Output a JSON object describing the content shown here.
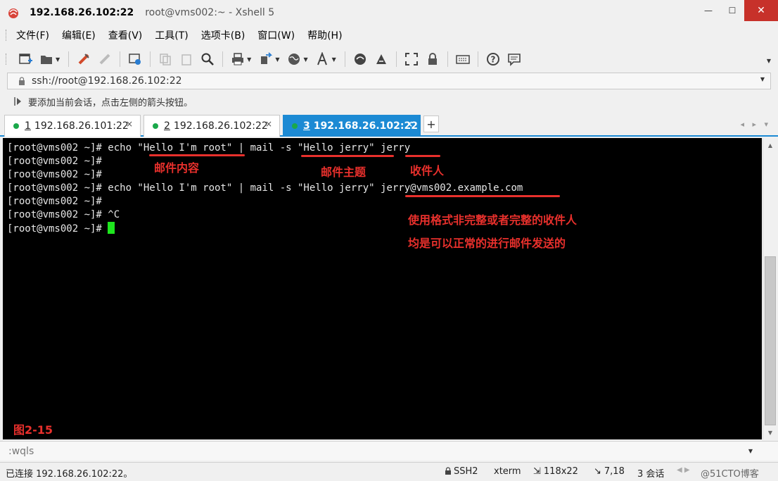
{
  "window": {
    "host": "192.168.26.102:22",
    "subtitle": "root@vms002:~ - Xshell 5",
    "minimize": "—",
    "maximize": "☐",
    "close": "✕"
  },
  "menu": [
    "文件(F)",
    "编辑(E)",
    "查看(V)",
    "工具(T)",
    "选项卡(B)",
    "窗口(W)",
    "帮助(H)"
  ],
  "address": {
    "value": "ssh://root@192.168.26.102:22"
  },
  "hint": {
    "text": "要添加当前会话，点击左侧的箭头按钮。"
  },
  "tabs": [
    {
      "num": "1",
      "label": "192.168.26.101:22",
      "status": "connected",
      "active": false
    },
    {
      "num": "2",
      "label": "192.168.26.102:22",
      "status": "connected",
      "active": false
    },
    {
      "num": "3",
      "label": "192.168.26.102:22",
      "status": "connected",
      "active": true
    }
  ],
  "tab_add": "+",
  "tab_nav": "◂ ▸ ▾",
  "tab_close": "×",
  "terminal": {
    "lines": [
      "[root@vms002 ~]# echo \"Hello I'm root\" | mail -s \"Hello jerry\" jerry",
      "[root@vms002 ~]#",
      "[root@vms002 ~]#",
      "[root@vms002 ~]# echo \"Hello I'm root\" | mail -s \"Hello jerry\" jerry@vms002.example.com",
      "[root@vms002 ~]#",
      "[root@vms002 ~]# ^C",
      "[root@vms002 ~]# "
    ],
    "cursor_color": "#1ee61e"
  },
  "annotations": {
    "mail_content": "邮件内容",
    "mail_subject": "邮件主题",
    "recipient": "收件人",
    "note_line1": "使用格式非完整或者完整的收件人",
    "note_line2": "均是可以正常的进行邮件发送的",
    "figure": "图2-15",
    "color": "#e8302c"
  },
  "compose": {
    "text": ":wqls"
  },
  "status": {
    "connected": "已连接 192.168.26.102:22。",
    "protocol": "SSH2",
    "terminal_type": "xterm",
    "size": "118x22",
    "cursor_pos": "7,18",
    "sessions": "3 会话",
    "watermark": "@51CTO博客"
  },
  "colors": {
    "tab_active": "#1c8ad4",
    "close_button": "#c7312a",
    "terminal_bg": "#000000"
  }
}
